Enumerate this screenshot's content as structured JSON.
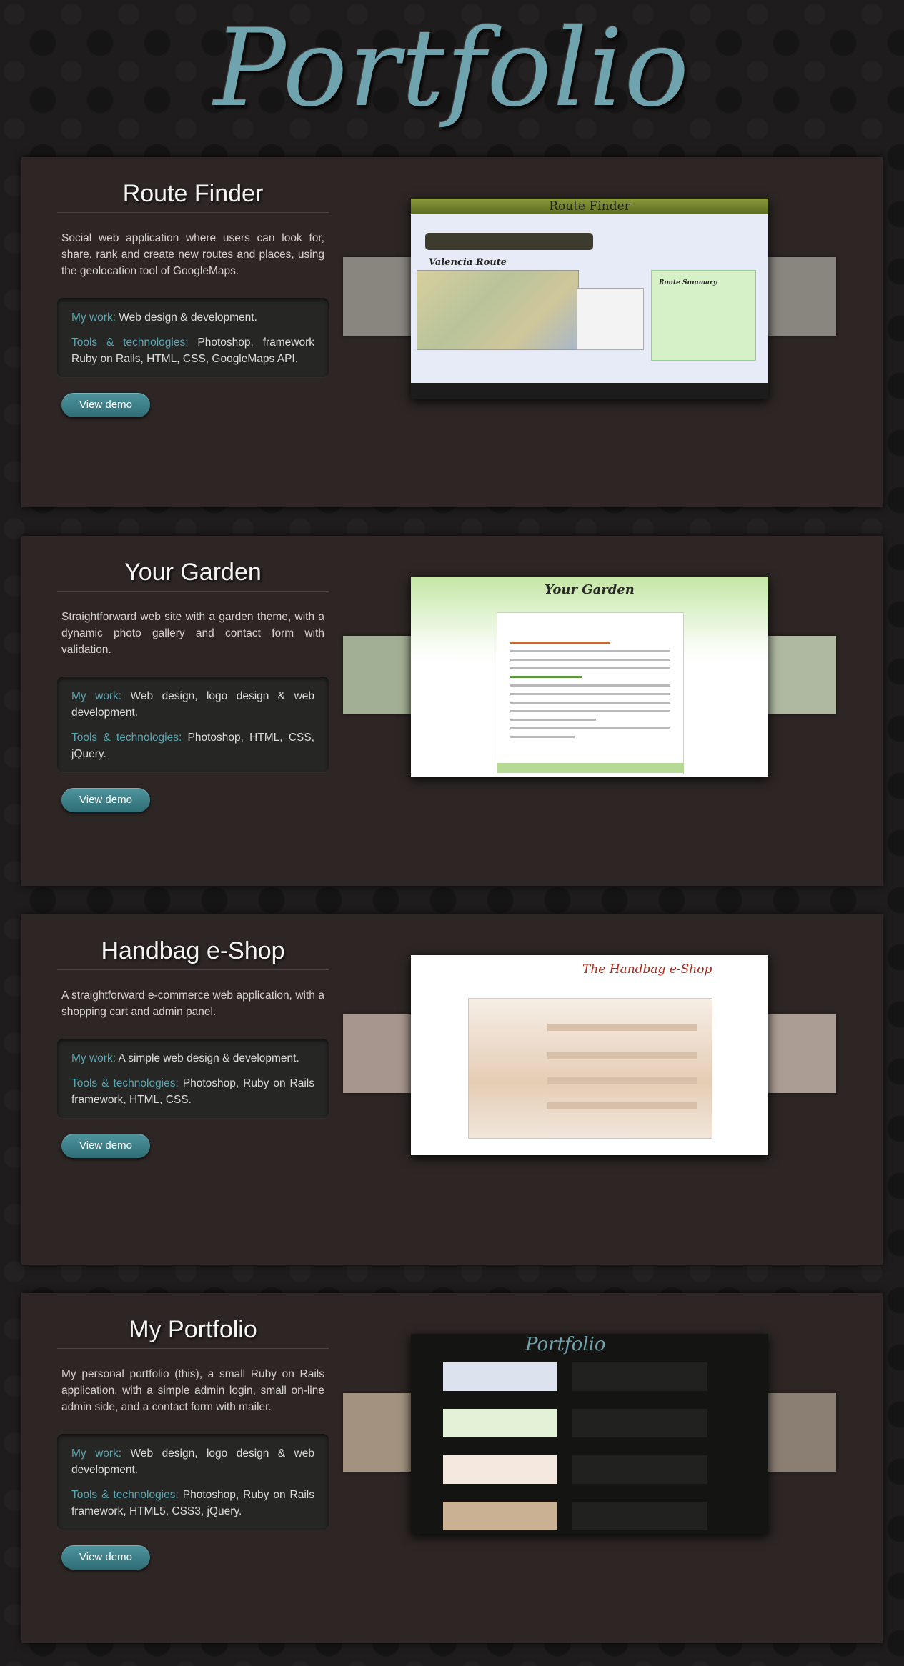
{
  "logo": "Portfolio",
  "projects": [
    {
      "title": "Route Finder",
      "description": "Social web application where users can look for, share, rank and create new routes and places, using the geolocation tool of GoogleMaps.",
      "work_label": "My work:",
      "work": " Web design & development.",
      "tools_label": "Tools & technologies:",
      "tools": " Photoshop, framework Ruby on Rails, HTML, CSS, GoogleMaps API.",
      "demo": "View demo",
      "shot_title": "Route Finder",
      "shot_route": "Valencia Route",
      "shot_summary": "Route Summary"
    },
    {
      "title": "Your Garden",
      "description": "Straightforward web site with a garden theme, with a dynamic photo gallery and contact form with validation.",
      "work_label": "My work:",
      "work": " Web design, logo design & web development.",
      "tools_label": "Tools & technologies:",
      "tools": " Photoshop, HTML, CSS, jQuery.",
      "demo": "View demo",
      "shot_title": "Your Garden"
    },
    {
      "title": "Handbag e-Shop",
      "description": "A straightforward e-commerce web application, with a shopping cart and admin panel.",
      "work_label": "My work:",
      "work": " A simple web design & development.",
      "tools_label": "Tools & technologies:",
      "tools": " Photoshop, Ruby on Rails framework, HTML, CSS.",
      "demo": "View demo",
      "shot_title": "The Handbag e-Shop"
    },
    {
      "title": "My Portfolio",
      "description": "My personal portfolio (this), a small Ruby on Rails application, with a simple admin login, small on-line admin side, and a contact form with mailer.",
      "work_label": "My work:",
      "work": " Web design, logo design & web development.",
      "tools_label": "Tools & technologies:",
      "tools": " Photoshop, Ruby on Rails framework, HTML5, CSS3, jQuery.",
      "demo": "View demo",
      "shot_title": "Portfolio"
    }
  ]
}
